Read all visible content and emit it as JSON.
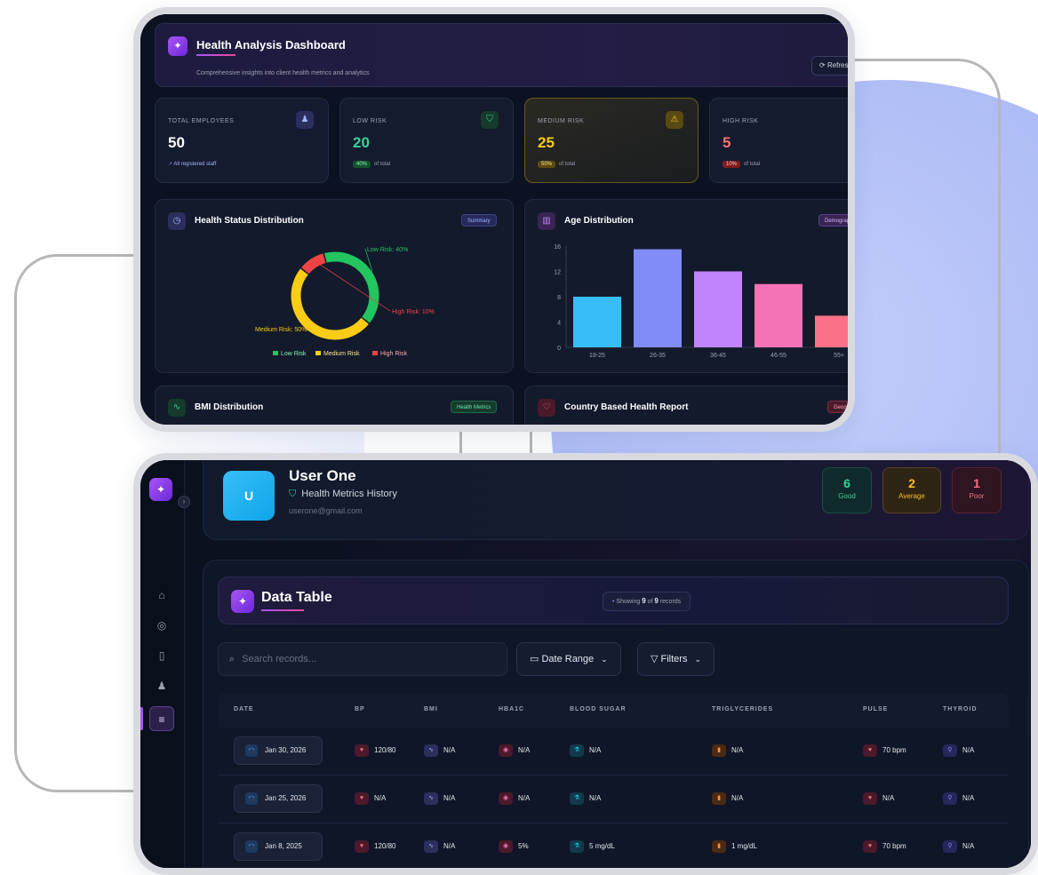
{
  "dashboard": {
    "title": "Health Analysis Dashboard",
    "subtitle": "Comprehensive insights into client health metrics and analytics",
    "refresh_label": "Refresh",
    "stats": [
      {
        "label": "TOTAL EMPLOYEES",
        "value": "50",
        "foot": "All registered staff",
        "icon": "users-icon",
        "color": "#e5e7eb"
      },
      {
        "label": "LOW RISK",
        "value": "20",
        "pct": "40%",
        "foot": "of total",
        "icon": "shield-check-icon",
        "color": "#34d399"
      },
      {
        "label": "MEDIUM RISK",
        "value": "25",
        "pct": "50%",
        "foot": "of total",
        "icon": "warning-icon",
        "color": "#facc15"
      },
      {
        "label": "HIGH RISK",
        "value": "5",
        "pct": "10%",
        "foot": "of total",
        "icon": "alert-icon",
        "color": "#f87171"
      }
    ],
    "panels": {
      "health_status": {
        "title": "Health Status Distribution",
        "badge": "Summary"
      },
      "age": {
        "title": "Age Distribution",
        "badge": "Demographics"
      },
      "bmi": {
        "title": "BMI Distribution",
        "badge": "Health Metrics"
      },
      "country": {
        "title": "Country Based Health Report",
        "badge": "Geography"
      }
    }
  },
  "chart_data": [
    {
      "type": "pie",
      "categories": [
        "Low Risk",
        "Medium Risk",
        "High Risk"
      ],
      "values": [
        40,
        50,
        10
      ],
      "data_labels": [
        "Low Risk: 40%",
        "Medium Risk: 50%",
        "High Risk: 10%"
      ],
      "colors": [
        "#22c55e",
        "#facc15",
        "#ef4444"
      ],
      "legend_position": "bottom"
    },
    {
      "type": "bar",
      "categories": [
        "18-25",
        "26-35",
        "36-45",
        "46-55",
        "55+"
      ],
      "values": [
        8,
        15.5,
        12,
        10,
        5
      ],
      "ylim": [
        0,
        16
      ],
      "yticks": [
        0,
        4,
        8,
        12,
        16
      ],
      "colors": [
        "#38bdf8",
        "#818cf8",
        "#c084fc",
        "#f472b6",
        "#fb7185"
      ]
    }
  ],
  "profile": {
    "initial": "U",
    "name": "User One",
    "subtitle": "Health Metrics History",
    "email": "userone@gmail.com",
    "scores": [
      {
        "value": "6",
        "label": "Good",
        "color": "#34d399",
        "bg": "#0f2a2a",
        "border": "#1f4a44"
      },
      {
        "value": "2",
        "label": "Average",
        "color": "#fbbf24",
        "bg": "#2e2414",
        "border": "#5a4220"
      },
      {
        "value": "1",
        "label": "Poor",
        "color": "#fb7185",
        "bg": "#2e1520",
        "border": "#5a2234"
      }
    ]
  },
  "table": {
    "title": "Data Table",
    "showing_prefix": "Showing",
    "showing_count": "9",
    "showing_of": "of",
    "showing_total": "9",
    "showing_suffix": "records",
    "search_placeholder": "Search records...",
    "date_range_label": "Date Range",
    "filters_label": "Filters",
    "columns": [
      "DATE",
      "BP",
      "BMI",
      "HBA1C",
      "BLOOD SUGAR",
      "TRIGLYCERIDES",
      "PULSE",
      "THYROID"
    ],
    "rows": [
      [
        "Jan 30, 2026",
        "120/80",
        "N/A",
        "N/A",
        "N/A",
        "N/A",
        "70 bpm",
        "N/A"
      ],
      [
        "Jan 25, 2026",
        "N/A",
        "N/A",
        "N/A",
        "N/A",
        "N/A",
        "N/A",
        "N/A"
      ],
      [
        "Jan 8, 2025",
        "120/80",
        "N/A",
        "5%",
        "5 mg/dL",
        "1 mg/dL",
        "70 bpm",
        "N/A"
      ]
    ]
  },
  "sidebar": {
    "items": [
      "home-icon",
      "location-icon",
      "building-icon",
      "users-icon",
      "database-icon"
    ]
  }
}
